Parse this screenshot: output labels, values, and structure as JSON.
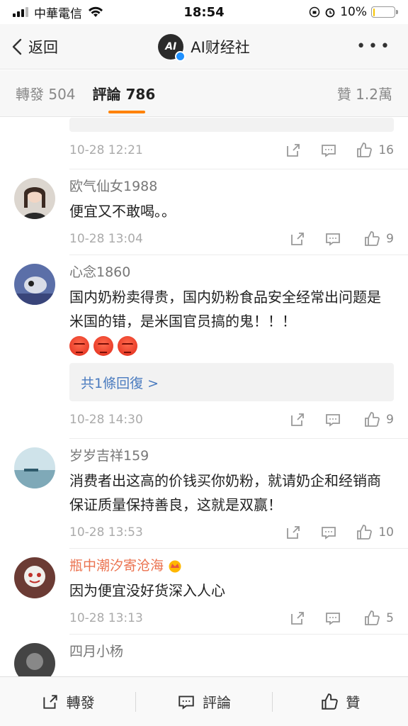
{
  "status_bar": {
    "carrier": "中華電信",
    "time": "18:54",
    "battery_percent": "10%",
    "battery_level": 0.1,
    "icons": [
      "signal-icon",
      "wifi-icon",
      "rotation-lock-icon",
      "alarm-icon",
      "battery-icon"
    ]
  },
  "nav": {
    "back_label": "返回",
    "title": "AI财经社",
    "avatar_text": "AI",
    "more_label": "•••"
  },
  "tabs": {
    "repost": "轉發 504",
    "comment": "評論 786",
    "like": "贊 1.2萬"
  },
  "top_partial": {
    "time": "10-28 12:21",
    "likes": "16"
  },
  "comments": [
    {
      "name": "欧气仙女1988",
      "text": "便宜又不敢喝。。",
      "time": "10-28 13:04",
      "likes": "9"
    },
    {
      "name": "心念1860",
      "text": "国内奶粉卖得贵，国内奶粉食品安全经常出问题是米国的错，是米国官员搞的鬼！！！",
      "emoji_count": 3,
      "reply_link": "共1條回復 >",
      "time": "10-28 14:30",
      "likes": "9"
    },
    {
      "name": "岁岁吉祥159",
      "text": "消费者出这高的价钱买你奶粉，就请奶企和经销商保证质量保持善良，这就是双赢！",
      "time": "10-28 13:53",
      "likes": "10"
    },
    {
      "name": "瓶中潮汐寄沧海",
      "text": "因为便宜没好货深入人心",
      "time": "10-28 13:13",
      "likes": "5"
    },
    {
      "name": "四月小杨"
    }
  ],
  "bottom_bar": {
    "repost": "轉發",
    "comment": "評論",
    "like": "贊"
  },
  "colors": {
    "accent": "#ff8200",
    "link": "#4a7bbf",
    "vip_name": "#eb7350",
    "verify": "#1e90ff"
  }
}
